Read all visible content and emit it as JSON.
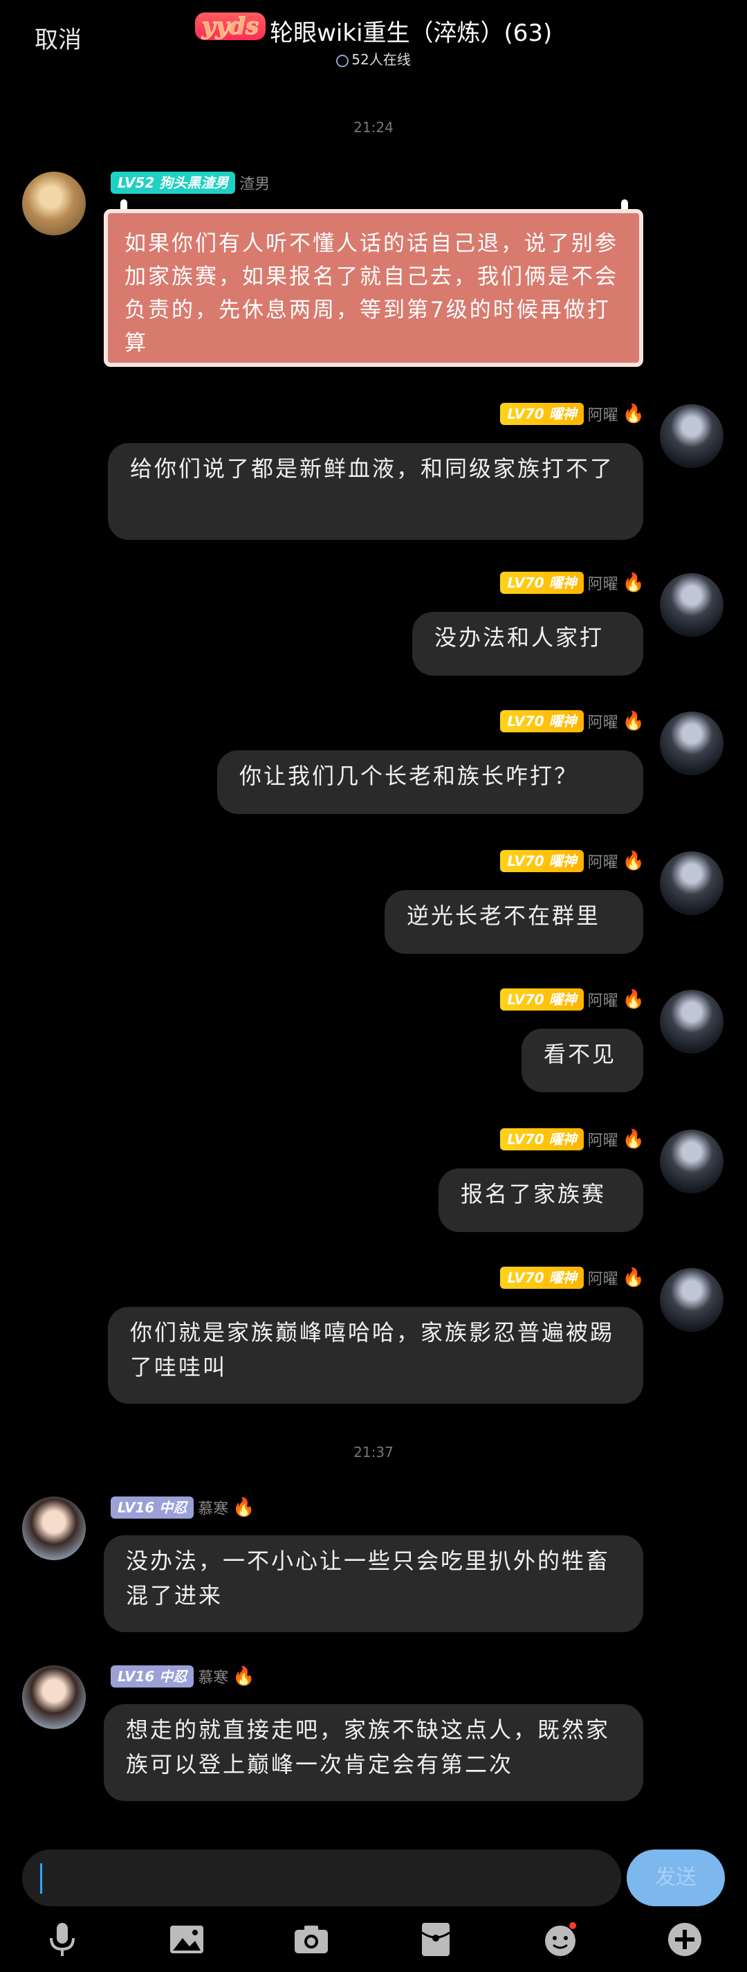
{
  "header": {
    "cancel": "取消",
    "brand": "yyds",
    "title": "轮眼wiki重生（淬炼）(63)",
    "online": "52人在线"
  },
  "times": [
    "21:24",
    "21:37"
  ],
  "messages": [
    {
      "level": "LV52 狗头黑渣男",
      "nick": "渣男",
      "text": "如果你们有人听不懂人话的话自己退，说了别参加家族赛，如果报名了就自己去，我们俩是不会负责的，先休息两周，等到第7级的时候再做打算"
    },
    {
      "level": "LV70 曜神",
      "nick": "阿曜",
      "text": "给你们说了都是新鲜血液，和同级家族打不了"
    },
    {
      "level": "LV70 曜神",
      "nick": "阿曜",
      "text": "没办法和人家打"
    },
    {
      "level": "LV70 曜神",
      "nick": "阿曜",
      "text": "你让我们几个长老和族长咋打？"
    },
    {
      "level": "LV70 曜神",
      "nick": "阿曜",
      "text": "逆光长老不在群里"
    },
    {
      "level": "LV70 曜神",
      "nick": "阿曜",
      "text": "看不见"
    },
    {
      "level": "LV70 曜神",
      "nick": "阿曜",
      "text": "报名了家族赛"
    },
    {
      "level": "LV70 曜神",
      "nick": "阿曜",
      "text": "你们就是家族巅峰嘻哈哈，家族影忍普遍被踢了哇哇叫"
    },
    {
      "level": "LV16 中忍",
      "nick": "慕寒",
      "text": "没办法，一不小心让一些只会吃里扒外的牲畜混了进来"
    },
    {
      "level": "LV16 中忍",
      "nick": "慕寒",
      "text": "想走的就直接走吧，家族不缺这点人，既然家族可以登上巅峰一次肯定会有第二次"
    }
  ],
  "input": {
    "value": "",
    "send": "发送"
  },
  "colors": {
    "background": "#000000",
    "bubble": "#2a2a2a",
    "pink_bubble": "#d97a6e",
    "accent": "#7cb7ee"
  },
  "toolbar_icons": [
    "microphone-icon",
    "image-icon",
    "camera-icon",
    "red-packet-icon",
    "emoji-icon",
    "plus-icon"
  ]
}
